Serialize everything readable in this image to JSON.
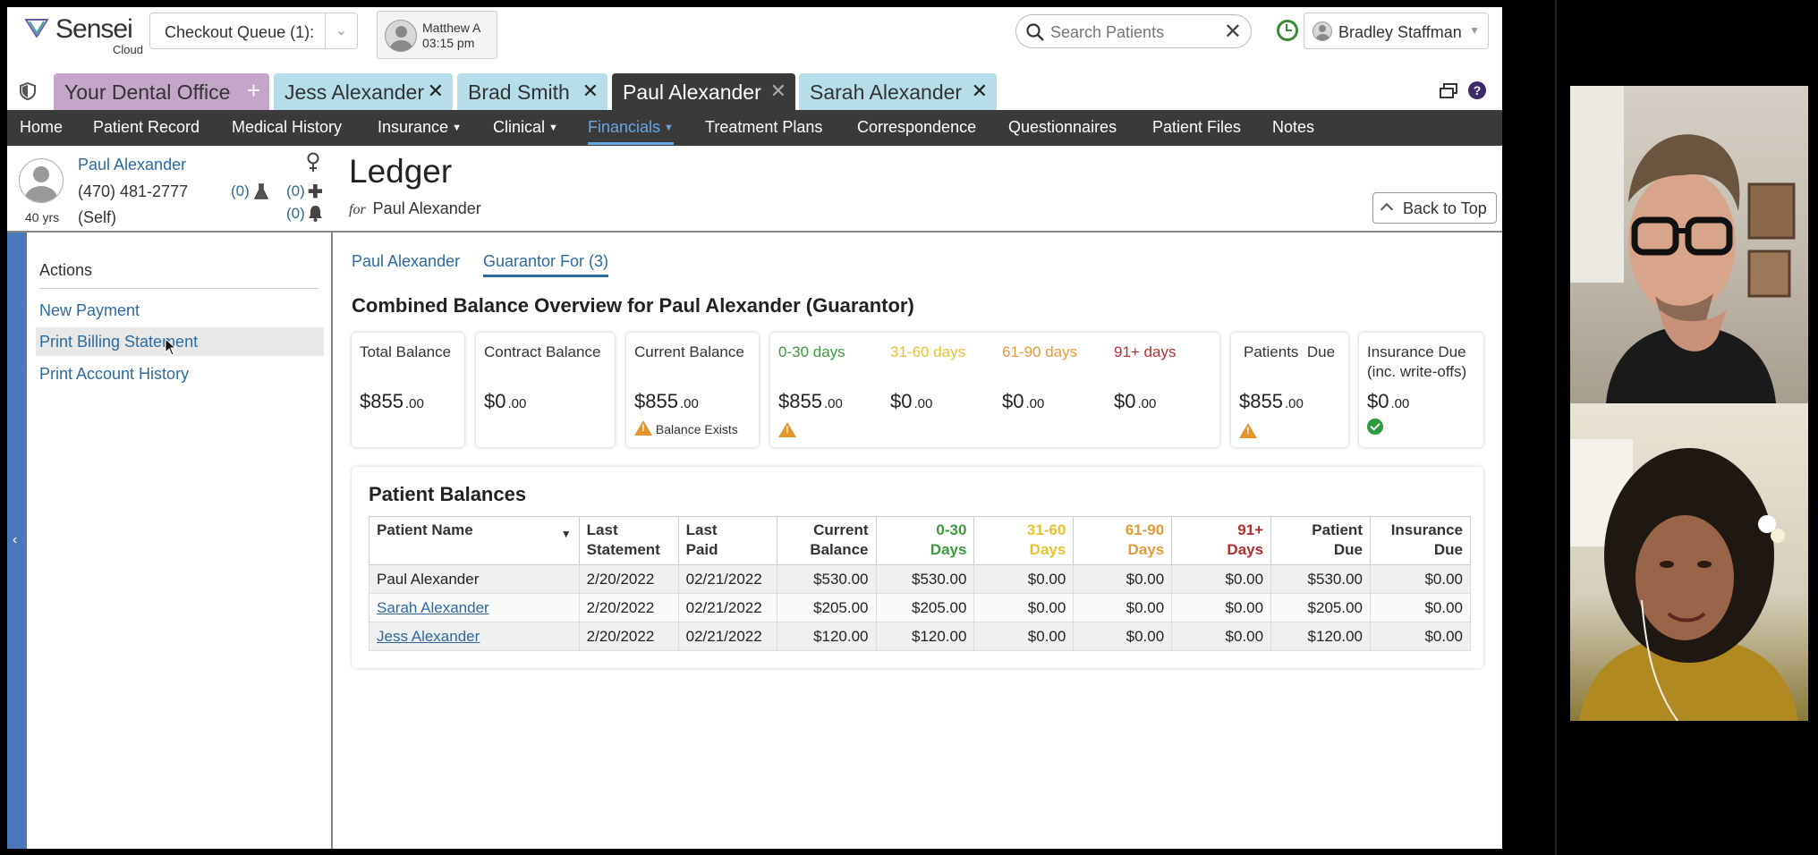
{
  "brand": {
    "name": "Sensei",
    "sub": "Cloud"
  },
  "queue": {
    "label": "Checkout Queue (1):"
  },
  "current_user": {
    "name": "Matthew A",
    "time": "03:15 pm"
  },
  "search": {
    "placeholder": "Search Patients"
  },
  "staff": {
    "name": "Bradley Staffman"
  },
  "patient_tabs": [
    {
      "label": "Your Dental Office",
      "close": "+"
    },
    {
      "label": "Jess Alexander",
      "close": "✕"
    },
    {
      "label": "Brad Smith",
      "close": "✕"
    },
    {
      "label": "Paul Alexander",
      "close": "✕"
    },
    {
      "label": "Sarah Alexander",
      "close": "✕"
    }
  ],
  "nav": [
    {
      "label": "Home"
    },
    {
      "label": "Patient Record"
    },
    {
      "label": "Medical History"
    },
    {
      "label": "Insurance"
    },
    {
      "label": "Clinical"
    },
    {
      "label": "Financials"
    },
    {
      "label": "Treatment Plans"
    },
    {
      "label": "Correspondence"
    },
    {
      "label": "Questionnaires"
    },
    {
      "label": "Patient Files"
    },
    {
      "label": "Notes"
    }
  ],
  "patient": {
    "name": "Paul Alexander",
    "phone": "(470) 481-2777",
    "relation": "(Self)",
    "age": "40 yrs",
    "lab_count": "(0)",
    "medical_count": "(0)",
    "alert_count": "(0)"
  },
  "page": {
    "title": "Ledger",
    "for_label": "for",
    "for_name": "Paul Alexander",
    "back_to_top": "Back to Top"
  },
  "actions": {
    "heading": "Actions",
    "items": [
      {
        "label": "New Payment"
      },
      {
        "label": "Print Billing Statement"
      },
      {
        "label": "Print Account History"
      }
    ]
  },
  "content_tabs": [
    {
      "label": "Paul Alexander"
    },
    {
      "label": "Guarantor For (3)"
    }
  ],
  "overview": {
    "heading": "Combined Balance Overview for Paul Alexander (Guarantor)",
    "total": {
      "label": "Total Balance",
      "value": "$855",
      "cents": ".00"
    },
    "contract": {
      "label": "Contract Balance",
      "value": "$0",
      "cents": ".00"
    },
    "current": {
      "label": "Current Balance",
      "value": "$855",
      "cents": ".00",
      "note": "Balance Exists"
    },
    "aging": [
      {
        "label": "0-30 days",
        "value": "$855",
        "cents": ".00",
        "color": "#3c9a3c"
      },
      {
        "label": "31-60 days",
        "value": "$0",
        "cents": ".00",
        "color": "#e6c232"
      },
      {
        "label": "61-90 days",
        "value": "$0",
        "cents": ".00",
        "color": "#e39a3a"
      },
      {
        "label": "91+ days",
        "value": "$0",
        "cents": ".00",
        "color": "#b03030"
      }
    ],
    "patients_due": {
      "label": "Patients  Due",
      "value": "$855",
      "cents": ".00"
    },
    "insurance_due": {
      "label": "Insurance Due",
      "label2": "(inc. write-offs)",
      "value": "$0",
      "cents": ".00"
    }
  },
  "balances": {
    "heading": "Patient Balances",
    "columns": [
      {
        "l1": "Patient Name",
        "l2": ""
      },
      {
        "l1": "Last",
        "l2": "Statement"
      },
      {
        "l1": "Last",
        "l2": "Paid"
      },
      {
        "l1": "Current",
        "l2": "Balance"
      },
      {
        "l1": "0-30",
        "l2": "Days"
      },
      {
        "l1": "31-60",
        "l2": "Days"
      },
      {
        "l1": "61-90",
        "l2": "Days"
      },
      {
        "l1": "91+",
        "l2": "Days"
      },
      {
        "l1": "Patient",
        "l2": "Due"
      },
      {
        "l1": "Insurance",
        "l2": "Due"
      }
    ],
    "rows": [
      [
        "Paul Alexander",
        "2/20/2022",
        "02/21/2022",
        "$530.00",
        "$530.00",
        "$0.00",
        "$0.00",
        "$0.00",
        "$530.00",
        "$0.00"
      ],
      [
        "Sarah Alexander",
        "2/20/2022",
        "02/21/2022",
        "$205.00",
        "$205.00",
        "$0.00",
        "$0.00",
        "$0.00",
        "$205.00",
        "$0.00"
      ],
      [
        "Jess Alexander",
        "2/20/2022",
        "02/21/2022",
        "$120.00",
        "$120.00",
        "$0.00",
        "$0.00",
        "$0.00",
        "$120.00",
        "$0.00"
      ]
    ]
  }
}
